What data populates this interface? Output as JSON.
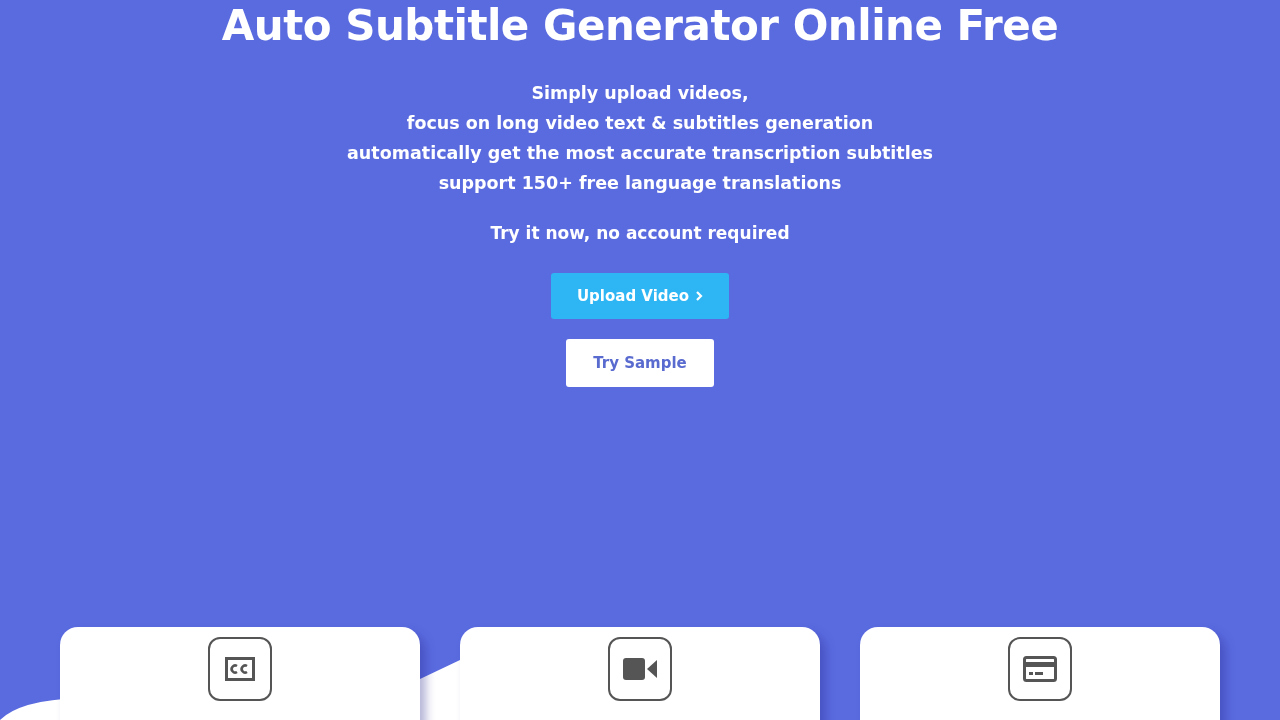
{
  "hero": {
    "title": "Auto Subtitle Generator Online Free",
    "lines": [
      "Simply upload videos,",
      "focus on long video text & subtitles generation",
      "automatically get the most accurate transcription subtitles",
      "support 150+ free language translations"
    ],
    "note": "Try it now, no account required",
    "primary_button": "Upload Video",
    "secondary_button": "Try Sample"
  },
  "features": [
    {
      "kind": "captions"
    },
    {
      "kind": "video"
    },
    {
      "kind": "card"
    }
  ]
}
